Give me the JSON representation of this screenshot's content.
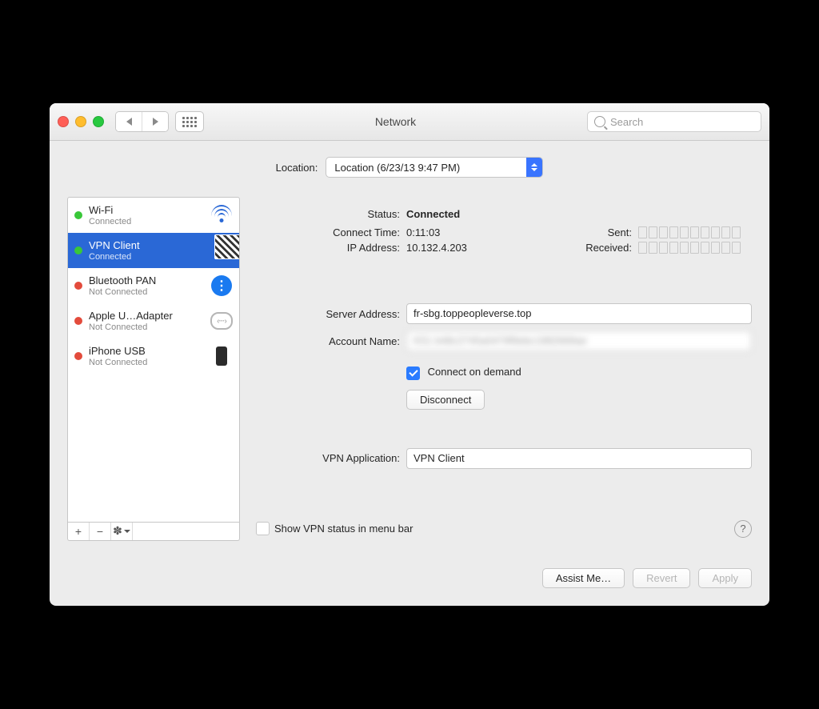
{
  "window": {
    "title": "Network",
    "search_placeholder": "Search"
  },
  "location": {
    "label": "Location:",
    "value": "Location (6/23/13 9:47 PM)"
  },
  "services": [
    {
      "name": "Wi-Fi",
      "status": "Connected",
      "led": "green",
      "icon": "wifi",
      "selected": false
    },
    {
      "name": "VPN Client",
      "status": "Connected",
      "led": "green",
      "icon": "lock",
      "selected": true
    },
    {
      "name": "Bluetooth PAN",
      "status": "Not Connected",
      "led": "red",
      "icon": "bt",
      "selected": false
    },
    {
      "name": "Apple U…Adapter",
      "status": "Not Connected",
      "led": "red",
      "icon": "eth",
      "selected": false
    },
    {
      "name": "iPhone USB",
      "status": "Not Connected",
      "led": "red",
      "icon": "phone",
      "selected": false
    }
  ],
  "detail": {
    "status_label": "Status:",
    "status_value": "Connected",
    "connect_time_label": "Connect Time:",
    "connect_time_value": "0:11:03",
    "ip_label": "IP Address:",
    "ip_value": "10.132.4.203",
    "sent_label": "Sent:",
    "received_label": "Received:",
    "server_label": "Server Address:",
    "server_value": "fr-sbg.toppeopleverse.top",
    "account_label": "Account Name:",
    "account_value": "K51 b48c2745a0479f9ebc1982669ae",
    "connect_on_demand": "Connect on demand",
    "disconnect": "Disconnect",
    "vpn_app_label": "VPN Application:",
    "vpn_app_value": "VPN Client",
    "show_status": "Show VPN status in menu bar"
  },
  "footer": {
    "assist": "Assist Me…",
    "revert": "Revert",
    "apply": "Apply"
  }
}
